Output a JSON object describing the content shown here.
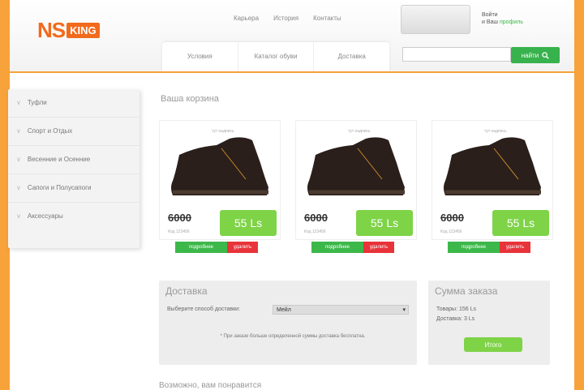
{
  "header": {
    "logo_ns": "NS",
    "logo_king": "KING",
    "topnav": [
      "Карьера",
      "История",
      "Контакты"
    ],
    "user_line1": "Войти",
    "user_line2": "и Ваш",
    "user_link": "профиль",
    "tabs": [
      "Условия",
      "Каталог обуви",
      "Доставка"
    ],
    "search_placeholder": "",
    "search_button": "найти"
  },
  "sidebar": {
    "items": [
      "Туфли",
      "Спорт и Отдых",
      "Весенние и Осенние",
      "Сапоги и Полусапоги",
      "Аксессуары"
    ]
  },
  "main": {
    "section_title": "Ваша корзина",
    "products": [
      {
        "tag": "тут надпись",
        "old_price": "6000",
        "small": "Код 123456",
        "price": "55 Ls",
        "add": "подробнее",
        "del": "удалить"
      },
      {
        "tag": "тут надпись",
        "old_price": "6000",
        "small": "Код 123456",
        "price": "55 Ls",
        "add": "подробнее",
        "del": "удалить"
      },
      {
        "tag": "тут надпись",
        "old_price": "6000",
        "small": "Код 123456",
        "price": "55 Ls",
        "add": "подробнее",
        "del": "удалить"
      }
    ],
    "delivery": {
      "title": "Доставка",
      "label": "Выберите способ доставки:",
      "selected": "Мейл",
      "note": "* При заказе больше определенной суммы доставка бесплатна."
    },
    "summary": {
      "title": "Сумма заказа",
      "line1": "Товары: 156 Ls",
      "line2": "Доставка: 3 Ls",
      "button": "Итого"
    },
    "bottom_title": "Возможно, вам понравится"
  },
  "colors": {
    "accent": "#f7a23a",
    "brand": "#f26a1c",
    "green": "#7ed347",
    "red": "#e8333a"
  }
}
